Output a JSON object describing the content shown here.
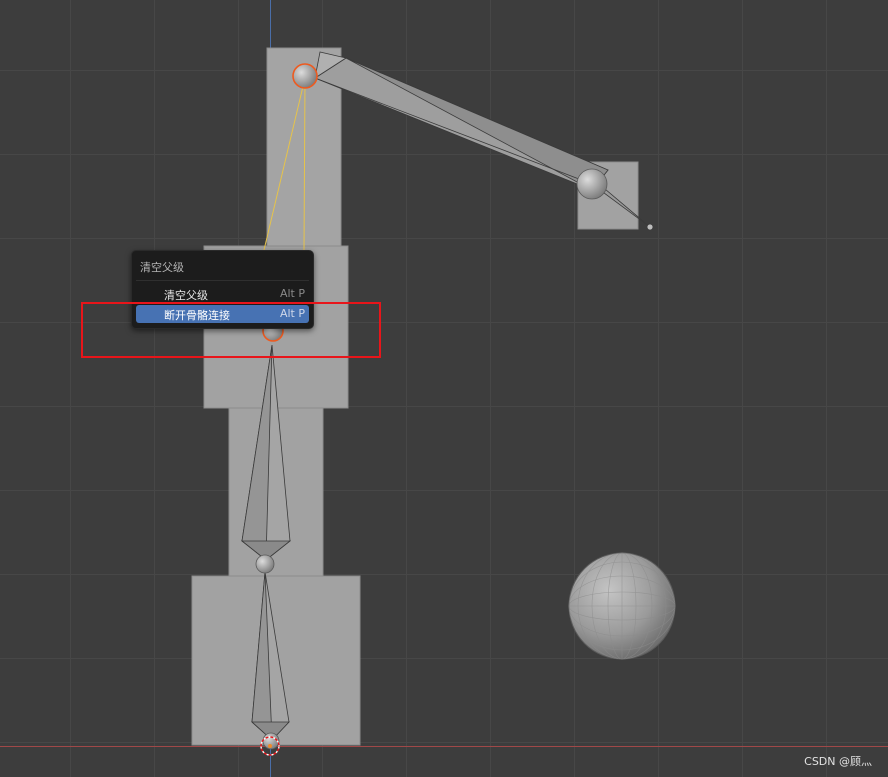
{
  "viewport": {
    "background": "#3d3d3d",
    "grid_color": "#474747"
  },
  "context_menu": {
    "title": "清空父级",
    "items": [
      {
        "label": "清空父级",
        "shortcut": "Alt P",
        "active": false
      },
      {
        "label": "断开骨骼连接",
        "shortcut": "Alt P",
        "active": true
      }
    ],
    "highlight_color": "#4772b3"
  },
  "annotation": {
    "box_color": "#e8151a"
  },
  "watermark": {
    "text": "CSDN @顾灬"
  },
  "colors": {
    "mesh": "#a2a2a2",
    "bone": "#999999",
    "selected_outline": "#ee5a1f",
    "relationship_line": "#e6c34a"
  }
}
